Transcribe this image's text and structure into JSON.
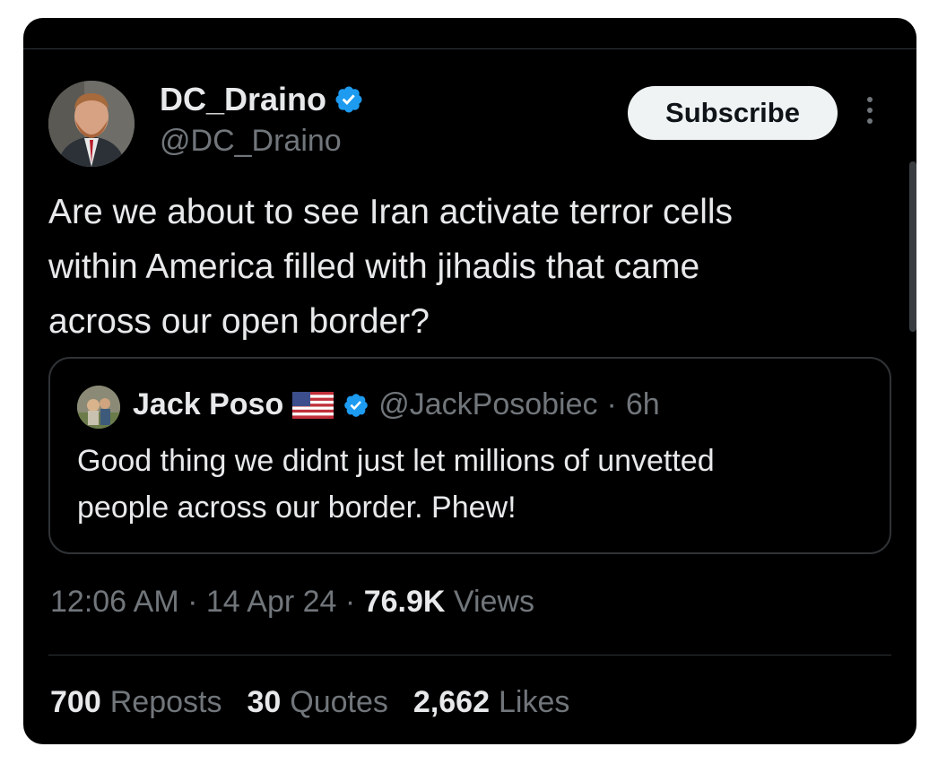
{
  "author": {
    "name": "DC_Draino",
    "handle": "@DC_Draino"
  },
  "subscribe_label": "Subscribe",
  "tweet": {
    "line1": "Are we about to see Iran activate terror cells",
    "line2": "within America filled with jihadis that came",
    "line3": "across our open border?"
  },
  "quoted": {
    "name": "Jack Poso",
    "handle": "@JackPosobiec",
    "separator": "·",
    "age": "6h",
    "line1": "Good thing we didnt just let millions of unvetted",
    "line2": "people across our border. Phew!"
  },
  "meta": {
    "time": "12:06 AM",
    "sep1": "·",
    "date": "14 Apr 24",
    "sep2": "·",
    "views_count": "76.9K",
    "views_label": "Views"
  },
  "stats": {
    "reposts_count": "700",
    "reposts_label": "Reposts",
    "quotes_count": "30",
    "quotes_label": "Quotes",
    "likes_count": "2,662",
    "likes_label": "Likes"
  },
  "colors": {
    "background": "#000000",
    "text": "#e7e9ea",
    "muted": "#71767b",
    "verified": "#1d9bf0",
    "button": "#eff3f4"
  },
  "icons": [
    "verified-badge-icon",
    "more-options-icon",
    "us-flag-icon"
  ]
}
